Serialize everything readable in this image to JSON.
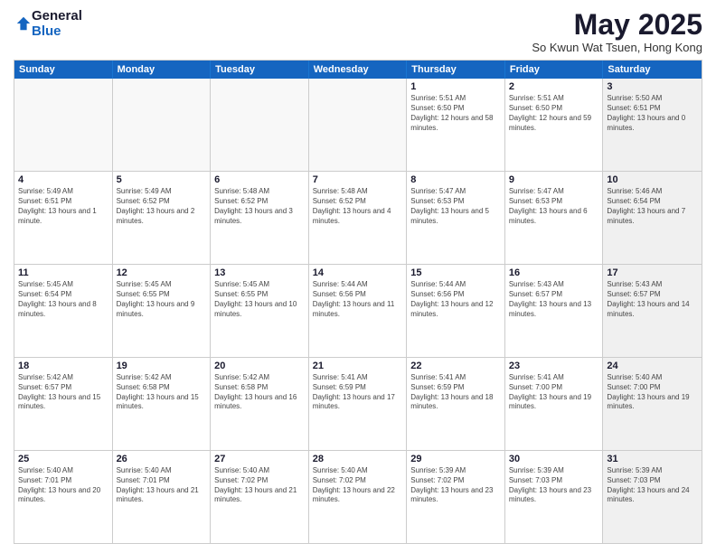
{
  "logo": {
    "general": "General",
    "blue": "Blue"
  },
  "title": "May 2025",
  "subtitle": "So Kwun Wat Tsuen, Hong Kong",
  "days": [
    "Sunday",
    "Monday",
    "Tuesday",
    "Wednesday",
    "Thursday",
    "Friday",
    "Saturday"
  ],
  "rows": [
    [
      {
        "day": "",
        "empty": true
      },
      {
        "day": "",
        "empty": true
      },
      {
        "day": "",
        "empty": true
      },
      {
        "day": "",
        "empty": true
      },
      {
        "day": "1",
        "rise": "Sunrise: 5:51 AM",
        "set": "Sunset: 6:50 PM",
        "daylight": "Daylight: 12 hours and 58 minutes."
      },
      {
        "day": "2",
        "rise": "Sunrise: 5:51 AM",
        "set": "Sunset: 6:50 PM",
        "daylight": "Daylight: 12 hours and 59 minutes."
      },
      {
        "day": "3",
        "rise": "Sunrise: 5:50 AM",
        "set": "Sunset: 6:51 PM",
        "daylight": "Daylight: 13 hours and 0 minutes.",
        "shaded": true
      }
    ],
    [
      {
        "day": "4",
        "rise": "Sunrise: 5:49 AM",
        "set": "Sunset: 6:51 PM",
        "daylight": "Daylight: 13 hours and 1 minute."
      },
      {
        "day": "5",
        "rise": "Sunrise: 5:49 AM",
        "set": "Sunset: 6:52 PM",
        "daylight": "Daylight: 13 hours and 2 minutes."
      },
      {
        "day": "6",
        "rise": "Sunrise: 5:48 AM",
        "set": "Sunset: 6:52 PM",
        "daylight": "Daylight: 13 hours and 3 minutes."
      },
      {
        "day": "7",
        "rise": "Sunrise: 5:48 AM",
        "set": "Sunset: 6:52 PM",
        "daylight": "Daylight: 13 hours and 4 minutes."
      },
      {
        "day": "8",
        "rise": "Sunrise: 5:47 AM",
        "set": "Sunset: 6:53 PM",
        "daylight": "Daylight: 13 hours and 5 minutes."
      },
      {
        "day": "9",
        "rise": "Sunrise: 5:47 AM",
        "set": "Sunset: 6:53 PM",
        "daylight": "Daylight: 13 hours and 6 minutes."
      },
      {
        "day": "10",
        "rise": "Sunrise: 5:46 AM",
        "set": "Sunset: 6:54 PM",
        "daylight": "Daylight: 13 hours and 7 minutes.",
        "shaded": true
      }
    ],
    [
      {
        "day": "11",
        "rise": "Sunrise: 5:45 AM",
        "set": "Sunset: 6:54 PM",
        "daylight": "Daylight: 13 hours and 8 minutes."
      },
      {
        "day": "12",
        "rise": "Sunrise: 5:45 AM",
        "set": "Sunset: 6:55 PM",
        "daylight": "Daylight: 13 hours and 9 minutes."
      },
      {
        "day": "13",
        "rise": "Sunrise: 5:45 AM",
        "set": "Sunset: 6:55 PM",
        "daylight": "Daylight: 13 hours and 10 minutes."
      },
      {
        "day": "14",
        "rise": "Sunrise: 5:44 AM",
        "set": "Sunset: 6:56 PM",
        "daylight": "Daylight: 13 hours and 11 minutes."
      },
      {
        "day": "15",
        "rise": "Sunrise: 5:44 AM",
        "set": "Sunset: 6:56 PM",
        "daylight": "Daylight: 13 hours and 12 minutes."
      },
      {
        "day": "16",
        "rise": "Sunrise: 5:43 AM",
        "set": "Sunset: 6:57 PM",
        "daylight": "Daylight: 13 hours and 13 minutes."
      },
      {
        "day": "17",
        "rise": "Sunrise: 5:43 AM",
        "set": "Sunset: 6:57 PM",
        "daylight": "Daylight: 13 hours and 14 minutes.",
        "shaded": true
      }
    ],
    [
      {
        "day": "18",
        "rise": "Sunrise: 5:42 AM",
        "set": "Sunset: 6:57 PM",
        "daylight": "Daylight: 13 hours and 15 minutes."
      },
      {
        "day": "19",
        "rise": "Sunrise: 5:42 AM",
        "set": "Sunset: 6:58 PM",
        "daylight": "Daylight: 13 hours and 15 minutes."
      },
      {
        "day": "20",
        "rise": "Sunrise: 5:42 AM",
        "set": "Sunset: 6:58 PM",
        "daylight": "Daylight: 13 hours and 16 minutes."
      },
      {
        "day": "21",
        "rise": "Sunrise: 5:41 AM",
        "set": "Sunset: 6:59 PM",
        "daylight": "Daylight: 13 hours and 17 minutes."
      },
      {
        "day": "22",
        "rise": "Sunrise: 5:41 AM",
        "set": "Sunset: 6:59 PM",
        "daylight": "Daylight: 13 hours and 18 minutes."
      },
      {
        "day": "23",
        "rise": "Sunrise: 5:41 AM",
        "set": "Sunset: 7:00 PM",
        "daylight": "Daylight: 13 hours and 19 minutes."
      },
      {
        "day": "24",
        "rise": "Sunrise: 5:40 AM",
        "set": "Sunset: 7:00 PM",
        "daylight": "Daylight: 13 hours and 19 minutes.",
        "shaded": true
      }
    ],
    [
      {
        "day": "25",
        "rise": "Sunrise: 5:40 AM",
        "set": "Sunset: 7:01 PM",
        "daylight": "Daylight: 13 hours and 20 minutes."
      },
      {
        "day": "26",
        "rise": "Sunrise: 5:40 AM",
        "set": "Sunset: 7:01 PM",
        "daylight": "Daylight: 13 hours and 21 minutes."
      },
      {
        "day": "27",
        "rise": "Sunrise: 5:40 AM",
        "set": "Sunset: 7:02 PM",
        "daylight": "Daylight: 13 hours and 21 minutes."
      },
      {
        "day": "28",
        "rise": "Sunrise: 5:40 AM",
        "set": "Sunset: 7:02 PM",
        "daylight": "Daylight: 13 hours and 22 minutes."
      },
      {
        "day": "29",
        "rise": "Sunrise: 5:39 AM",
        "set": "Sunset: 7:02 PM",
        "daylight": "Daylight: 13 hours and 23 minutes."
      },
      {
        "day": "30",
        "rise": "Sunrise: 5:39 AM",
        "set": "Sunset: 7:03 PM",
        "daylight": "Daylight: 13 hours and 23 minutes."
      },
      {
        "day": "31",
        "rise": "Sunrise: 5:39 AM",
        "set": "Sunset: 7:03 PM",
        "daylight": "Daylight: 13 hours and 24 minutes.",
        "shaded": true
      }
    ]
  ]
}
